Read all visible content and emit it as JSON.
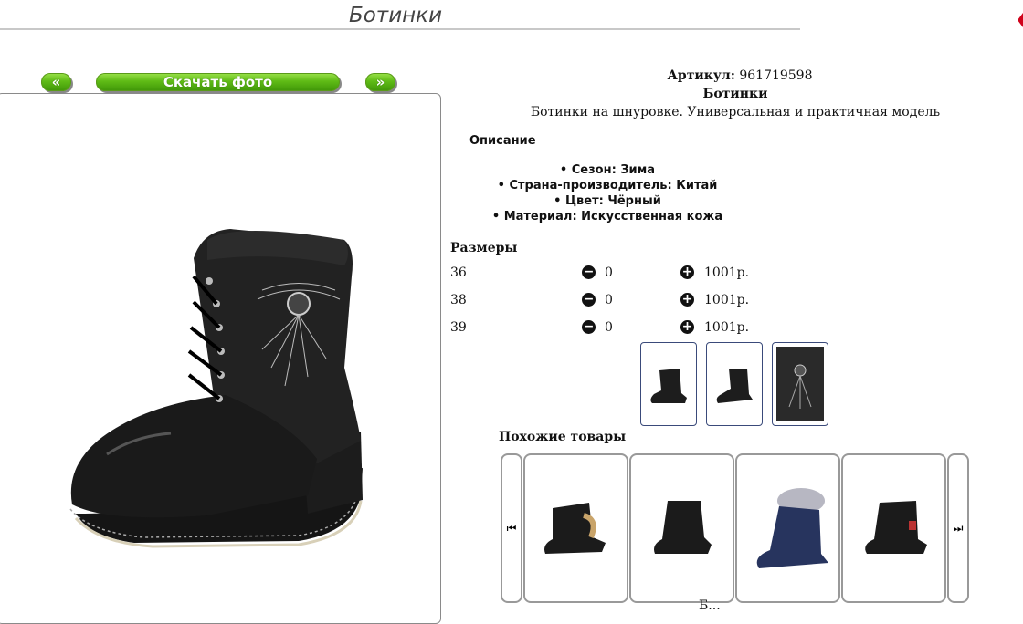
{
  "header": {
    "title": "Ботинки"
  },
  "gallery": {
    "prev_label": "«",
    "download_label": "Скачать фото",
    "next_label": "»"
  },
  "product": {
    "sku_label": "Артикул:",
    "sku_value": "961719598",
    "name": "Ботинки",
    "short_description": "Ботинки на шнуровке. Универсальная и практичная модель",
    "description_heading": "Описание",
    "features": [
      "Сезон: Зима",
      "Страна-производитель: Китай",
      "Цвет: Чёрный",
      "Материал: Искусственная кожа"
    ],
    "sizes_heading": "Размеры",
    "sizes": [
      {
        "size": "36",
        "qty": "0",
        "price": "1001р."
      },
      {
        "size": "38",
        "qty": "0",
        "price": "1001р."
      },
      {
        "size": "39",
        "qty": "0",
        "price": "1001р."
      }
    ]
  },
  "similar": {
    "heading": "Похожие товары",
    "prev_icon": "skip-previous-icon",
    "next_icon": "skip-next-icon",
    "cut_caption": "Б..."
  },
  "colors": {
    "button_green": "#5fbb16",
    "thumb_border": "#3a4a7a"
  }
}
